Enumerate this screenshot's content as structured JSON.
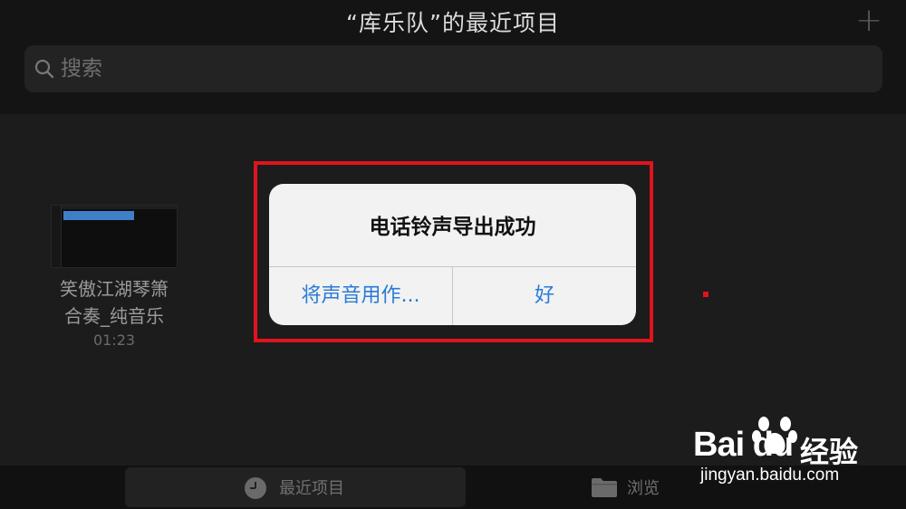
{
  "header": {
    "title": "“库乐队”的最近项目",
    "add_label": "+"
  },
  "search": {
    "placeholder": "搜索"
  },
  "projects": [
    {
      "name_line1": "笑傲江湖琴箫",
      "name_line2": "合奏_纯音乐",
      "duration": "01:23"
    }
  ],
  "dialog": {
    "title": "电话铃声导出成功",
    "use_as_label": "将声音用作...",
    "ok_label": "好"
  },
  "tabbar": {
    "recent_label": "最近项目",
    "browse_label": "浏览"
  },
  "watermark": {
    "brand": "Bai du",
    "experience": "经验",
    "url": "jingyan.baidu.com"
  },
  "colors": {
    "accent_blue": "#2a7bd6",
    "highlight_red": "#e0141e",
    "background": "#1c1c1c"
  }
}
